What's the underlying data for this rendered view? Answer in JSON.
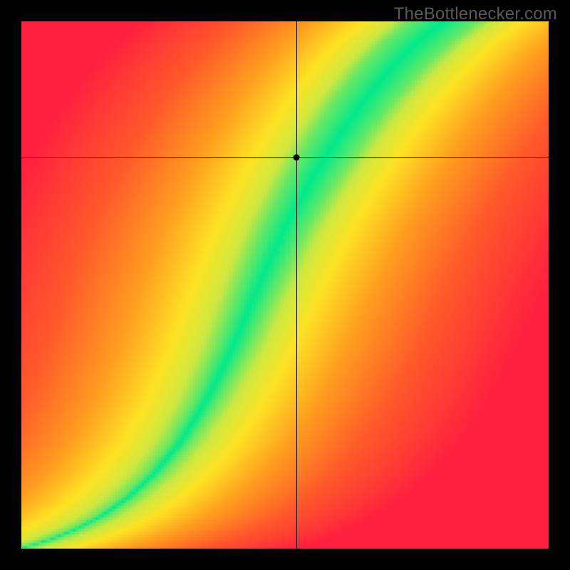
{
  "watermark": "TheBottlenecker.com",
  "chart_data": {
    "type": "heatmap",
    "title": "",
    "xlabel": "",
    "ylabel": "",
    "xlim": [
      0,
      1
    ],
    "ylim": [
      0,
      1
    ],
    "grid_resolution": 185,
    "comment": "Value at each cell is distance (in x-direction) from a ridge curve y=f(x). Color ramp: green (0) → yellow (~0.08) → orange (~0.25) → red (≥0.45). Ridge broadens with y (half-width grows from ~0.01 at y=0 to ~0.06 at y=1).",
    "ridge_curve_points": [
      {
        "x": 0.0,
        "y": 0.0
      },
      {
        "x": 0.05,
        "y": 0.015
      },
      {
        "x": 0.1,
        "y": 0.035
      },
      {
        "x": 0.15,
        "y": 0.06
      },
      {
        "x": 0.2,
        "y": 0.095
      },
      {
        "x": 0.25,
        "y": 0.14
      },
      {
        "x": 0.3,
        "y": 0.2
      },
      {
        "x": 0.35,
        "y": 0.28
      },
      {
        "x": 0.4,
        "y": 0.38
      },
      {
        "x": 0.45,
        "y": 0.5
      },
      {
        "x": 0.5,
        "y": 0.61
      },
      {
        "x": 0.55,
        "y": 0.7
      },
      {
        "x": 0.6,
        "y": 0.78
      },
      {
        "x": 0.65,
        "y": 0.85
      },
      {
        "x": 0.7,
        "y": 0.91
      },
      {
        "x": 0.75,
        "y": 0.96
      },
      {
        "x": 0.8,
        "y": 1.0
      }
    ],
    "color_stops": [
      {
        "t": 0.0,
        "color": "#00e98b"
      },
      {
        "t": 0.12,
        "color": "#cfe840"
      },
      {
        "t": 0.22,
        "color": "#fde324"
      },
      {
        "t": 0.4,
        "color": "#ff9f1f"
      },
      {
        "t": 0.65,
        "color": "#ff5a2a"
      },
      {
        "t": 1.0,
        "color": "#ff1f3f"
      }
    ],
    "crosshair": {
      "x": 0.521,
      "y": 0.742
    },
    "axis_color": "#000000"
  }
}
